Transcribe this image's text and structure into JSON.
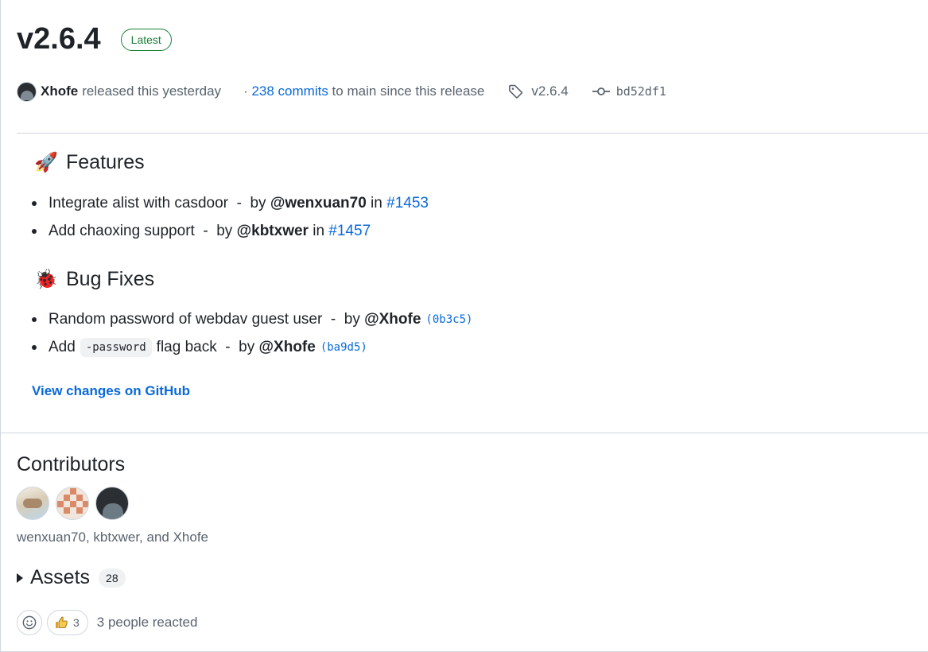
{
  "release": {
    "title": "v2.6.4",
    "latest_badge": "Latest",
    "author": "Xhofe",
    "released_text": "released this yesterday",
    "commits_prefix": "· ",
    "commits_link": "238 commits",
    "commits_suffix": " to main since this release",
    "tag": "v2.6.4",
    "commit_sha": "bd52df1"
  },
  "features": {
    "emoji": "🚀",
    "title": "Features",
    "items": [
      {
        "text": "Integrate alist with casdoor",
        "sep": "  -  by ",
        "mention": "@wenxuan70",
        "in": " in ",
        "ref": "#1453"
      },
      {
        "text": "Add chaoxing support",
        "sep": "  -  by ",
        "mention": "@kbtxwer",
        "in": " in ",
        "ref": "#1457"
      }
    ]
  },
  "bugfixes": {
    "emoji": "🐞",
    "title": "Bug Fixes",
    "items": [
      {
        "text": "Random password of webdav guest user",
        "sep": "  -  by ",
        "mention": "@Xhofe",
        "hash": "(0b3c5)"
      },
      {
        "text_before": "Add",
        "code": "-password",
        "text_after": "flag back",
        "sep": "  -  by ",
        "mention": "@Xhofe",
        "hash": "(ba9d5)"
      }
    ]
  },
  "view_changes": "View changes on GitHub",
  "contributors": {
    "title": "Contributors",
    "names": "wenxuan70, kbtxwer, and Xhofe"
  },
  "assets": {
    "title": "Assets",
    "count": "28"
  },
  "reactions": {
    "thumbs_up_count": "3",
    "text": "3 people reacted"
  },
  "icons": {
    "tag": "tag-icon",
    "commit": "git-commit-icon",
    "smiley": "smiley-icon",
    "thumbs_up": "thumbs-up-icon"
  },
  "colors": {
    "link": "#0969da",
    "latest": "#1a7f37",
    "muted": "#59636e",
    "text": "#1f2328",
    "border": "#d0d7de"
  }
}
